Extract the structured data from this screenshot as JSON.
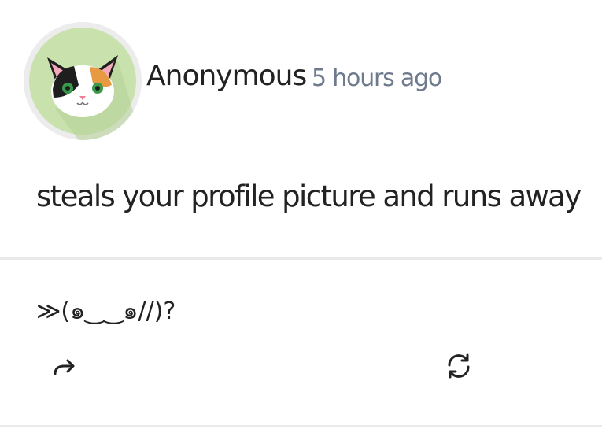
{
  "post": {
    "author": "Anonymous",
    "timestamp": "5 hours ago",
    "avatar_icon": "calico-cat-avatar-icon",
    "body": "steals your profile picture and runs away"
  },
  "reply": {
    "text": "≫(๑‿‿๑//)?"
  },
  "actions": {
    "share_icon": "share-arrow-icon",
    "refresh_icon": "refresh-icon"
  },
  "colors": {
    "avatar_bg": "#c9e2ad",
    "avatar_ring": "#ececec",
    "timestamp": "#6f7b8d",
    "divider": "#e8eaec"
  }
}
